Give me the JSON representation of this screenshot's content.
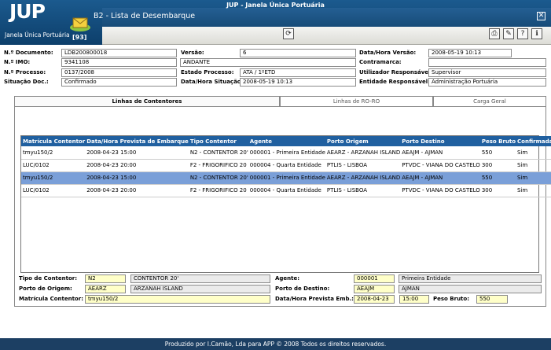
{
  "app": {
    "logo": "JUP",
    "subtitle": "Janela Única Portuária",
    "title": "JUP - Janela Única Portuária",
    "screen_title": "B2 - Lista de Desembarque",
    "badge": "[93]",
    "close_glyph": "✕"
  },
  "toolbar": {
    "refresh_glyph": "⟳",
    "print_glyph": "⎙",
    "edit_glyph": "✎",
    "help_glyph": "?",
    "info_glyph": "ℹ"
  },
  "header_fields": {
    "numero_documento": {
      "label": "N.º Documento:",
      "value": "LDB200800018"
    },
    "versao": {
      "label": "Versão:",
      "value": "6"
    },
    "data_hora_versao": {
      "label": "Data/Hora Versão:",
      "value": "2008-05-19 10:13"
    },
    "numero_imo": {
      "label": "N.º IMO:",
      "value": "9341108"
    },
    "navio": {
      "label": "",
      "value": "ANDANTE"
    },
    "contramarca": {
      "label": "Contramarca:",
      "value": ""
    },
    "numero_processo": {
      "label": "N.º Processo:",
      "value": "0137/2008"
    },
    "estado_processo": {
      "label": "Estado Processo:",
      "value": "ATA / 1ºETD"
    },
    "utilizador_responsavel": {
      "label": "Utilizador Responsável:",
      "value": "Supervisor"
    },
    "situacao_doc": {
      "label": "Situação Doc.:",
      "value": "Confirmado"
    },
    "data_hora_situacao": {
      "label": "Data/Hora Situação:",
      "value": "2008-05-19 10:13"
    },
    "entidade_responsavel": {
      "label": "Entidade Responsável:",
      "value": "Administração Portuária"
    }
  },
  "tabs": [
    {
      "label": "Linhas de Contentores",
      "active": true
    },
    {
      "label": "Linhas de RO-RO",
      "active": false
    },
    {
      "label": "Carga Geral",
      "active": false
    }
  ],
  "grid": {
    "columns": [
      "Matrícula Contentor",
      "Data/Hora Prevista de Embarque",
      "Tipo Contentor",
      "Agente",
      "Porto Origem",
      "Porto Destino",
      "Peso Bruto",
      "Confirmada"
    ],
    "rows": [
      [
        "tmyu150/2",
        "2008-04-23 15:00",
        "N2 - CONTENTOR 20'",
        "000001 - Primeira Entidade",
        "AEARZ - ARZANAH ISLAND",
        "AEAJM - AJMAN",
        "550",
        "Sim"
      ],
      [
        "LUC/0102",
        "2008-04-23 20:00",
        "F2 - FRIGORIFICO 20",
        "000004 - Quarta Entidade",
        "PTLIS - LISBOA",
        "PTVDC - VIANA DO CASTELO",
        "300",
        "Sim"
      ],
      [
        "tmyu150/2",
        "2008-04-23 15:00",
        "N2 - CONTENTOR 20'",
        "000001 - Primeira Entidade",
        "AEARZ - ARZANAH ISLAND",
        "AEAJM - AJMAN",
        "550",
        "Sim"
      ],
      [
        "LUC/0102",
        "2008-04-23 20:00",
        "F2 - FRIGORIFICO 20",
        "000004 - Quarta Entidade",
        "PTLIS - LISBOA",
        "PTVDC - VIANA DO CASTELO",
        "300",
        "Sim"
      ]
    ],
    "selected_row": 2
  },
  "detail": {
    "tipo_contentor": {
      "label": "Tipo de Contentor:",
      "code": "N2",
      "desc": "CONTENTOR 20'"
    },
    "porto_origem": {
      "label": "Porto de Origem:",
      "code": "AEARZ",
      "desc": "ARZANAH ISLAND"
    },
    "matricula": {
      "label": "Matrícula Contentor:",
      "value": "tmyu150/2"
    },
    "agente": {
      "label": "Agente:",
      "code": "000001",
      "desc": "Primeira Entidade"
    },
    "porto_destino": {
      "label": "Porto de Destino:",
      "code": "AEAJM",
      "desc": "AJMAN"
    },
    "data_hora_prevista": {
      "label": "Data/Hora Prevista Emb.:",
      "date": "2008-04-23",
      "time": "15:00"
    },
    "peso_bruto": {
      "label": "Peso Bruto:",
      "value": "550"
    }
  },
  "footer": {
    "text": "Produzido por I.Camão, Lda para APP © 2008 Todos os direitos reservados."
  }
}
